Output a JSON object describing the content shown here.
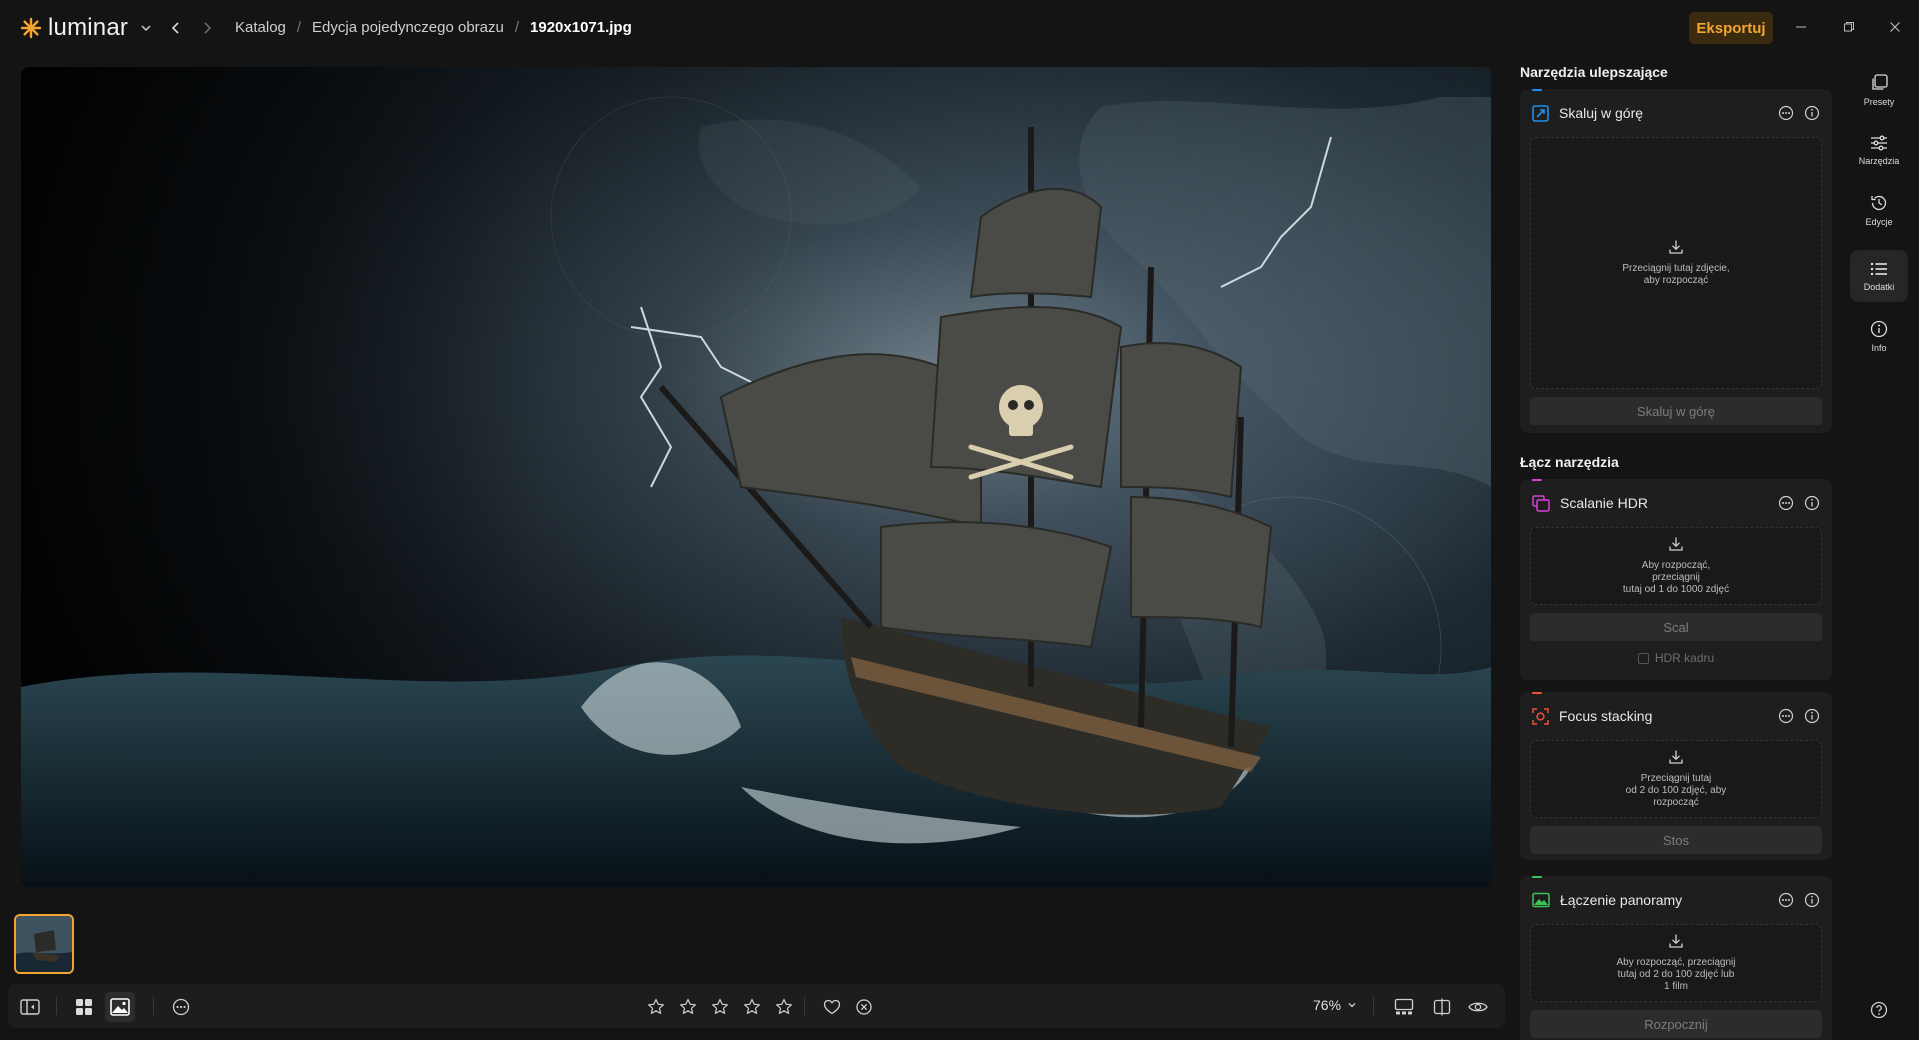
{
  "app": {
    "brand": "luminar",
    "accent_color": "#f2a531"
  },
  "header": {
    "breadcrumbs": [
      "Katalog",
      "Edycja pojedynczego obrazu",
      "1920x1071.jpg"
    ],
    "separator": "/",
    "export_label": "Eksportuj"
  },
  "bottom_toolbar": {
    "zoom": "76%",
    "rating_stars": 5
  },
  "panel": {
    "section_enhance": "Narzędzia ulepszające",
    "section_merge": "Łącz narzędzia",
    "upscale": {
      "title": "Skaluj w górę",
      "drop_text": "Przeciągnij tutaj zdjęcie,\naby rozpocząć",
      "button": "Skaluj w górę",
      "accent": "#1e8ff0"
    },
    "hdr": {
      "title": "Scalanie HDR",
      "drop_text": "Aby rozpocząć,\nprzeciągnij\ntutaj od 1 do 1000 zdjęć",
      "button": "Scal",
      "checkbox_label": "HDR kadru",
      "accent": "#d83fd6"
    },
    "focus": {
      "title": "Focus stacking",
      "drop_text": "Przeciągnij tutaj\nod 2 do 100 zdjęć, aby\nrozpocząć",
      "button": "Stos",
      "accent": "#f0503c"
    },
    "panorama": {
      "title": "Łączenie panoramy",
      "drop_text": "Aby rozpocząć, przeciągnij\ntutaj od 2 do 100 zdjęć lub\n1 film",
      "button": "Rozpocznij",
      "accent": "#3ec25a"
    }
  },
  "rail": {
    "items": [
      {
        "label": "Presety",
        "icon": "presets-icon"
      },
      {
        "label": "Narzędzia",
        "icon": "sliders-icon"
      },
      {
        "label": "Edycje",
        "icon": "history-icon"
      },
      {
        "label": "Dodatki",
        "icon": "list-icon"
      },
      {
        "label": "Info",
        "icon": "info-icon"
      }
    ],
    "help_icon": "help-icon"
  }
}
